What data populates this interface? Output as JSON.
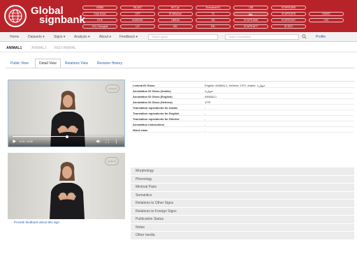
{
  "brand": {
    "line1": "Global",
    "line2": "signbank"
  },
  "datasets": {
    "row1": [
      "NSBM",
      "ISLANT",
      "NGT (in",
      "Zimbabwe/SL",
      "LSB",
      "IS WPD1805"
    ],
    "row2": [
      "Kata Kolok",
      "VGT",
      "IS Wthdrwn",
      "TIL",
      "ISL",
      "IS WPD1878",
      "SWHIS"
    ],
    "row3": [
      "ETIS",
      "MANNSD",
      "LIBRAS",
      "JSL",
      "IS WPD1868",
      "IS WPD1957",
      "LSC"
    ],
    "row4": [
      "GSL Shanghai",
      "LIS",
      "ASL",
      "KSL",
      "IS WPD1877",
      "IS 2021"
    ],
    "active": "ISL"
  },
  "nav": {
    "items": [
      "Home",
      "Datasets ▾",
      "Signs ▾",
      "Analysis ▾",
      "About ▾",
      "Feedback ▾"
    ],
    "gloss_search_placeholder": "Search gloss",
    "translation_search_placeholder": "Search translation",
    "profile": "Profile"
  },
  "gloss_tabs": [
    "ANIMAL1",
    "ANIMAL2",
    "RED-ANIMAL"
  ],
  "view_tabs": [
    "Public View",
    "Detail View",
    "Relations View",
    "Revision History"
  ],
  "video": {
    "time": "0:01 / 0:02",
    "progress": 0.5,
    "watermark": "signbank"
  },
  "feedback_link": "Provide feedback about this sign",
  "info_rows": [
    {
      "label": "Lemma ID Gloss",
      "value": "English: ANIMAL1, Hebrew: 1חיה, Arabic: 1حيوان"
    },
    {
      "label": "Annotation ID Gloss (Arabic)",
      "value": "1حيوان"
    },
    {
      "label": "Annotation ID Gloss (English)",
      "value": "ANIMAL1"
    },
    {
      "label": "Annotation ID Gloss (Hebrew)",
      "value": "1חיה"
    },
    {
      "label": "Translation equivalents for Arabic",
      "value": "-"
    },
    {
      "label": "Translation equivalents for English",
      "value": "-"
    },
    {
      "label": "Translation equivalents for Hebrew",
      "value": "-"
    },
    {
      "label": "Annotation instructions",
      "value": "-"
    },
    {
      "label": "Word class",
      "value": "-"
    }
  ],
  "accordion": [
    "Morphology",
    "Phonology",
    "Minimal Pairs",
    "Semantics",
    "Relations to Other Signs",
    "Relations to Foreign Signs",
    "Publication Status",
    "Notes",
    "Other media"
  ],
  "colors": {
    "header": "#b8232a",
    "link": "#2a62b8",
    "panel": "#ececec"
  }
}
